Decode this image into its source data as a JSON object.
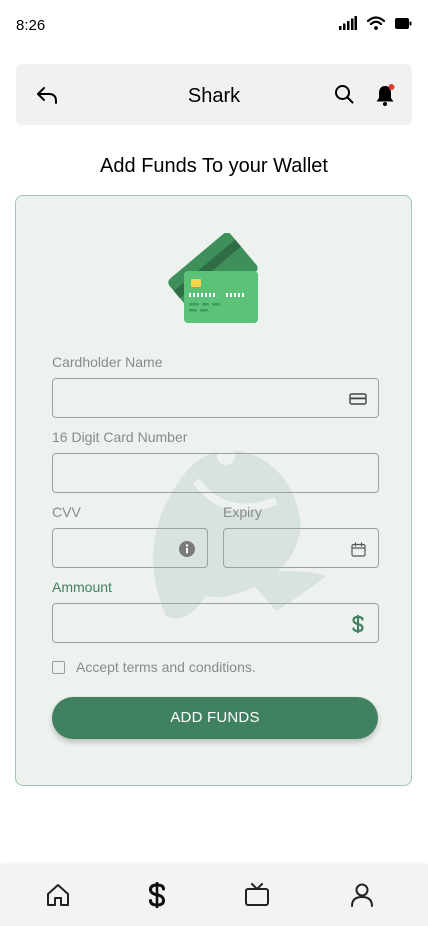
{
  "status_bar": {
    "time": "8:26"
  },
  "header": {
    "title": "Shark",
    "icons": [
      "back-arrow-icon",
      "search-icon",
      "bell-icon"
    ],
    "notification_dot_color": "#e53935"
  },
  "page": {
    "heading": "Add Funds To your Wallet"
  },
  "form": {
    "cardholder_label": "Cardholder Name",
    "cardholder_value": "",
    "card_number_label": "16 Digit Card Number",
    "card_number_value": "",
    "cvv_label": "CVV",
    "cvv_value": "",
    "expiry_label": "Expiry",
    "expiry_value": "",
    "amount_label": "Ammount",
    "amount_value": "",
    "terms_label": "Accept terms and conditions.",
    "terms_checked": false,
    "submit_label": "ADD FUNDS"
  },
  "bottom_nav": {
    "items": [
      "home-icon",
      "dollar-icon",
      "tv-icon",
      "user-icon"
    ]
  },
  "colors": {
    "accent": "#3f8160",
    "panel_bg": "#edf2ef",
    "panel_border": "#9fc9b0",
    "header_bg": "#f1f1f1"
  }
}
